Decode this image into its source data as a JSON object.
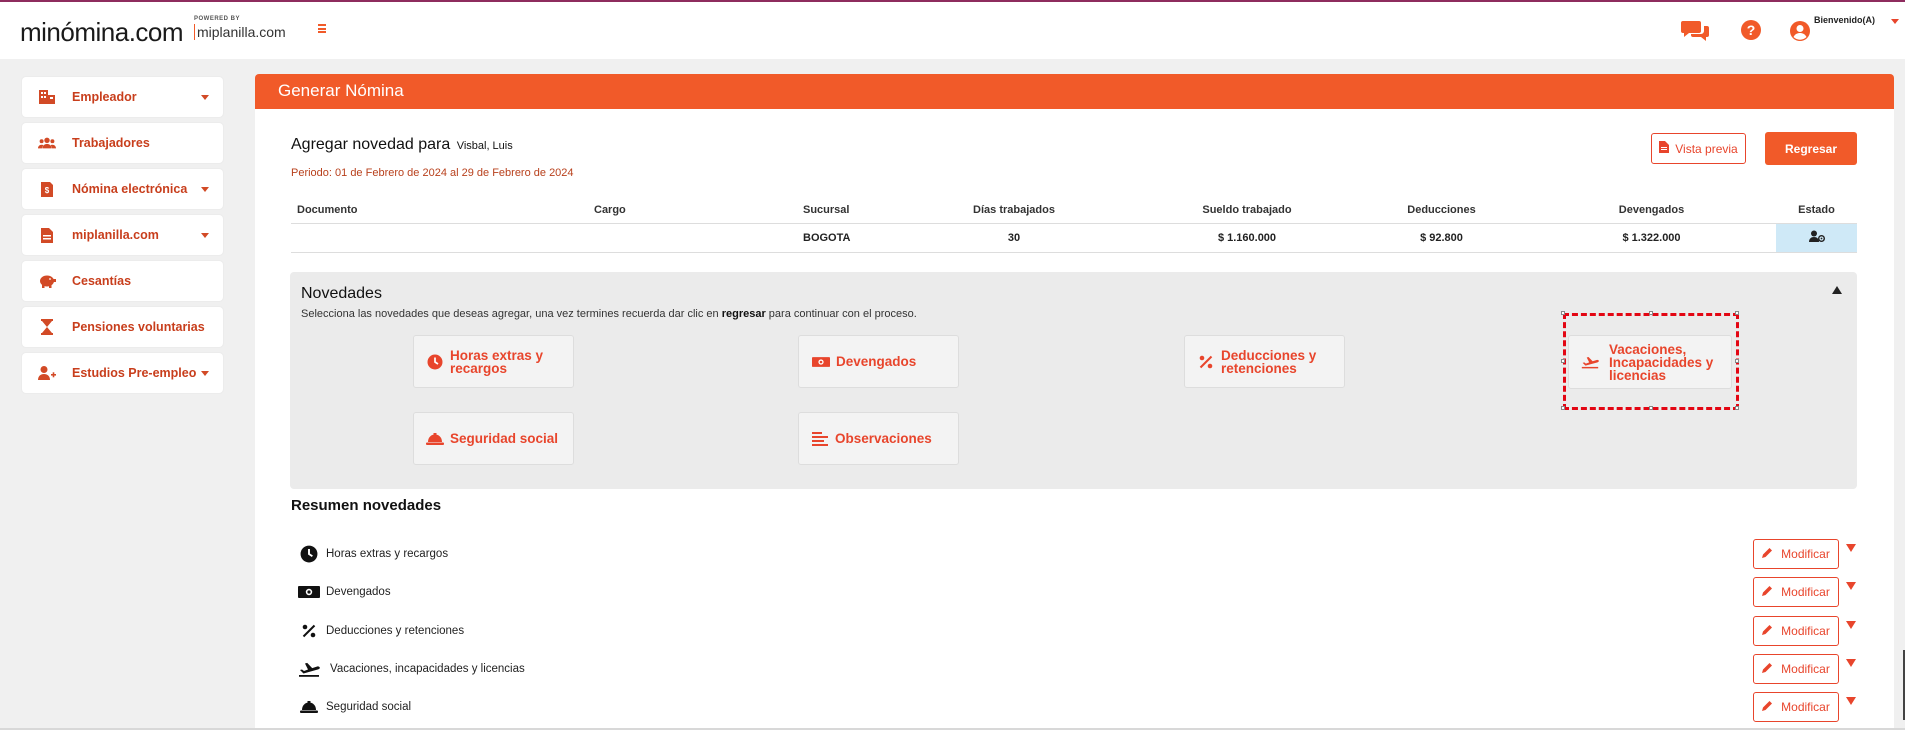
{
  "header": {
    "logo": "minómina.com",
    "powered_by": "POWERED BY",
    "powered_brand": "miplanilla.com",
    "welcome": "Bienvenido(A)"
  },
  "sidebar": {
    "items": [
      {
        "label": "Empleador",
        "icon": "building-icon",
        "has_caret": true
      },
      {
        "label": "Trabajadores",
        "icon": "users-icon",
        "has_caret": false
      },
      {
        "label": "Nómina electrónica",
        "icon": "invoice-icon",
        "has_caret": true
      },
      {
        "label": "miplanilla.com",
        "icon": "document-icon",
        "has_caret": true
      },
      {
        "label": "Cesantías",
        "icon": "piggy-bank-icon",
        "has_caret": false
      },
      {
        "label": "Pensiones voluntarias",
        "icon": "hourglass-icon",
        "has_caret": false
      },
      {
        "label": "Estudios Pre-empleo",
        "icon": "user-plus-icon",
        "has_caret": true
      }
    ]
  },
  "main": {
    "title": "Generar Nómina",
    "agregar_label": "Agregar novedad para",
    "employee_name": "Visbal, Luis",
    "periodo": "Periodo: 01 de Febrero de 2024 al 29 de Febrero de 2024",
    "preview_button": "Vista previa",
    "back_button": "Regresar",
    "table": {
      "headers": [
        "Documento",
        "Cargo",
        "Sucursal",
        "Días trabajados",
        "Sueldo trabajado",
        "Deducciones",
        "Devengados",
        "Estado"
      ],
      "row": {
        "documento": "",
        "cargo": "",
        "sucursal": "BOGOTA",
        "dias": "30",
        "sueldo": "$ 1.160.000",
        "deducciones": "$ 92.800",
        "devengados": "$ 1.322.000"
      }
    }
  },
  "novedades": {
    "title": "Novedades",
    "desc_pre": "Selecciona las novedades que deseas agregar, una vez termines recuerda dar clic en ",
    "desc_bold": "regresar",
    "desc_post": " para continuar con el proceso.",
    "cards": [
      {
        "label": "Horas extras y recargos",
        "icon": "clock-icon"
      },
      {
        "label": "Devengados",
        "icon": "money-icon"
      },
      {
        "label": "Deducciones y retenciones",
        "icon": "percent-icon"
      },
      {
        "label": "Vacaciones, Incapacidades y licencias",
        "icon": "plane-icon"
      },
      {
        "label": "Seguridad social",
        "icon": "hard-hat-icon"
      },
      {
        "label": "Observaciones",
        "icon": "align-left-icon"
      }
    ]
  },
  "resumen": {
    "title": "Resumen novedades",
    "items": [
      {
        "label": "Horas extras y recargos",
        "icon": "clock-icon"
      },
      {
        "label": "Devengados",
        "icon": "money-icon"
      },
      {
        "label": "Deducciones y retenciones",
        "icon": "percent-icon"
      },
      {
        "label": "Vacaciones, incapacidades y licencias",
        "icon": "plane-icon"
      },
      {
        "label": "Seguridad social",
        "icon": "hard-hat-icon"
      }
    ],
    "modify_label": "Modificar"
  },
  "colors": {
    "accent": "#f15a29",
    "accent_dark": "#c83e1c",
    "selection": "#e30613"
  }
}
